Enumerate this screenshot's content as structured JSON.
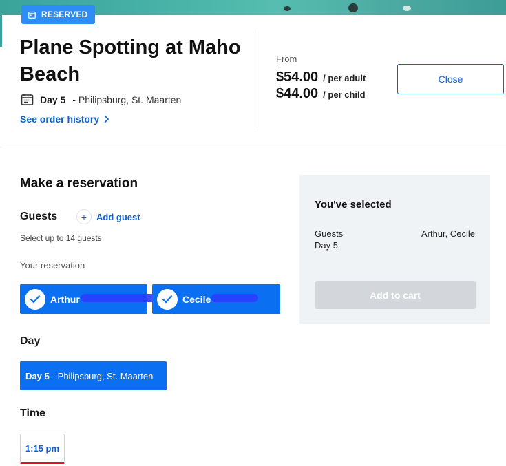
{
  "badge": {
    "label": "RESERVED",
    "icon": "calendar-icon"
  },
  "tour": {
    "title": "Plane Spotting at Maho Beach",
    "day": "Day 5",
    "place": "- Philipsburg, St. Maarten",
    "history_link": "See order history"
  },
  "pricing": {
    "from_label": "From",
    "adult_price": "$54.00",
    "adult_unit": "/ per adult",
    "child_price": "$44.00",
    "child_unit": "/ per child"
  },
  "close_label": "Close",
  "reservation": {
    "heading": "Make a reservation",
    "guests_label": "Guests",
    "add_guest_label": "Add guest",
    "add_guest_icon": "+",
    "hint": "Select up to 14 guests",
    "your_reservation_label": "Your reservation",
    "guests": [
      {
        "name": "Arthur",
        "selected": true
      },
      {
        "name": "Cecile",
        "selected": true
      }
    ],
    "day_label": "Day",
    "day_option": {
      "day": "Day 5",
      "place": "- Philipsburg, St. Maarten"
    },
    "time_label": "Time",
    "time_option": "1:15 pm"
  },
  "summary": {
    "heading": "You've selected",
    "guests_label": "Guests",
    "day_value": "Day 5",
    "guests_value": "Arthur, Cecile",
    "cart_label": "Add to cart"
  },
  "colors": {
    "accent_blue": "#0a6ff0",
    "link_blue": "#0c5fd6",
    "badge_blue": "#2e8df5",
    "time_underline": "#e0112b",
    "summary_bg": "#f0f3f6",
    "disabled_button": "#d3d6da"
  }
}
